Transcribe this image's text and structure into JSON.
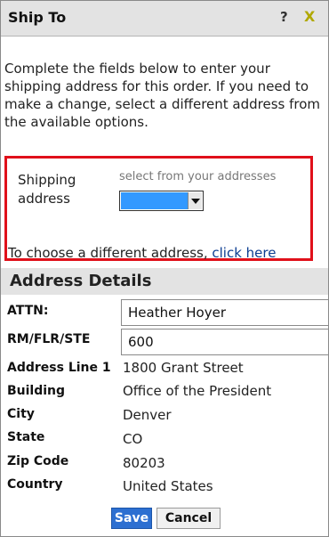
{
  "dialog": {
    "title": "Ship To",
    "help_label": "?",
    "close_label": "X"
  },
  "intro": {
    "text": "Complete the fields below to enter your shipping address for this order. If you need to make a change, select a different address from the available options."
  },
  "shipping": {
    "label": "Shipping address",
    "hint": "select from your addresses",
    "choose_prefix": "To choose a different address, ",
    "choose_link": "click here"
  },
  "details": {
    "title": "Address Details",
    "attn_label": "ATTN:",
    "attn_value": "Heather Hoyer",
    "rm_label": "RM/FLR/STE",
    "rm_value": "600",
    "line1_label": "Address Line 1",
    "line1_value": "1800 Grant Street",
    "building_label": "Building",
    "building_value": "Office of the President",
    "city_label": "City",
    "city_value": "Denver",
    "state_label": "State",
    "state_value": "CO",
    "zip_label": "Zip Code",
    "zip_value": "80203",
    "country_label": "Country",
    "country_value": "United States"
  },
  "actions": {
    "save_label": "Save",
    "cancel_label": "Cancel"
  },
  "colors": {
    "highlight": "#e0101a",
    "save_button": "#2c6fd1",
    "selected_option": "#3399ff",
    "close_icon": "#b0a800"
  }
}
